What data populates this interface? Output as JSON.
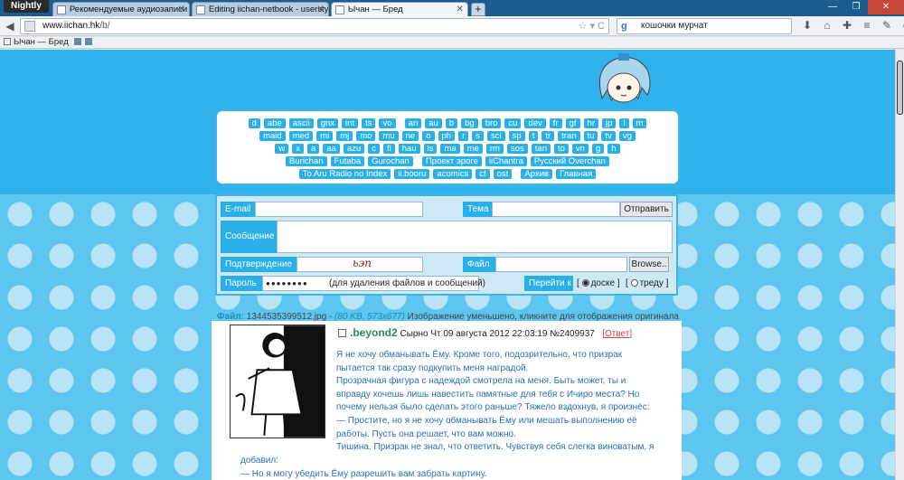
{
  "browser": {
    "app_menu": "Nightly",
    "tabs": [
      {
        "title": "Рекомендуемые аудиозаписи"
      },
      {
        "title": "Editing iichan-netbook - userstyles.org"
      },
      {
        "title": "Ычан — Бред"
      }
    ],
    "address": {
      "domain": "www.iichan.hk",
      "path": "/b/"
    },
    "search": {
      "value": "кошочки мурчат"
    },
    "bookmark": "Ычан — Бред"
  },
  "boards": {
    "rows": [
      [
        "d",
        "abe",
        "ascii",
        "gnx",
        "int",
        "ts",
        "vo",
        "an",
        "au",
        "b",
        "bg",
        "bro",
        "cu",
        "dev",
        "fr",
        "gf",
        "hr",
        "jp",
        "l",
        "m"
      ],
      [
        "maid",
        "med",
        "mi",
        "mj",
        "mo",
        "mu",
        "ne",
        "o",
        "ph",
        "r",
        "s",
        "sci",
        "sp",
        "t",
        "tr",
        "tran",
        "tu",
        "tv",
        "vg"
      ],
      [
        "w",
        "x",
        "a",
        "aa",
        "azu",
        "c",
        "fi",
        "hau",
        "ls",
        "ma",
        "me",
        "rm",
        "sos",
        "tan",
        "to",
        "vn",
        "g",
        "h"
      ],
      [
        "Burichan",
        "Futaba",
        "Gurochan",
        "Проект эроге",
        "iiChantra",
        "Русский Overchan"
      ],
      [
        "To Aru Radio no Index",
        "ii.booru",
        "acomics",
        "cf",
        "ost",
        "Архив",
        "Главная"
      ]
    ]
  },
  "form": {
    "email_label": "E-mail",
    "subject_label": "Тема",
    "send_label": "Отправить",
    "message_label": "Сообщение",
    "captcha_label": "Подтверждение",
    "captcha_text": "ьэп",
    "file_label": "Файл",
    "browse_label": "Browse..",
    "password_label": "Пароль",
    "password_value": "●●●●●●●●",
    "password_hint": "(для удаления файлов и сообщений)",
    "goto_label": "Перейти к",
    "goto_board": "доске",
    "goto_thread": "треду"
  },
  "post": {
    "file_prefix": "Файл:",
    "file_name": "1344535399512.jpg",
    "file_meta": "(80 KB, 573x677)",
    "file_note": "Изображение уменьшено, кликните для отображения оригинала",
    "name": ".beyond2",
    "subject": "Сырно",
    "date": "Чт 09 августа 2012 22:03:19",
    "number": "№2409937",
    "reply": "Ответ",
    "lines": [
      "Я не хочу обманывать Ёму. Кроме того, подозрительно, что призрак",
      "пытается так сразу подкупить меня наградой.",
      "Прозрачная фигура с надеждой смотрела на меня. Быть может, ты и",
      "вправду хочешь лишь навестить памятные для тебя с Ичиро места? Но",
      "почему нельзя было сделать этого раньше? Тяжело вздохнув, я произнёс:",
      "— Простите, но я не хочу обманывать Ёму или мешать выполнению её",
      "работы. Пусть она решает, что вам можно.",
      "Тишина. Призрак не знал, что ответить. Чувствуя себя слегка виноватым, я"
    ],
    "lines_wide": [
      "добавил:",
      "— Но я могу убедить Ёму разрешить вам забрать картину."
    ]
  }
}
